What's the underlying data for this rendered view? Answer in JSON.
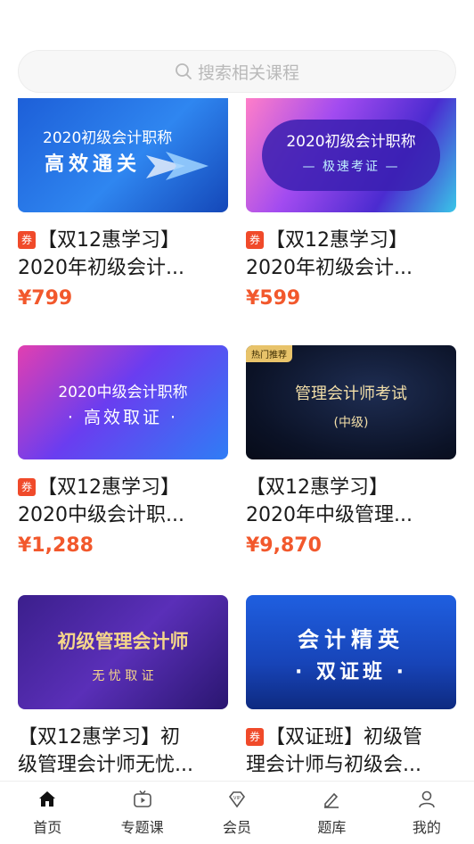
{
  "search": {
    "placeholder": "搜索相关课程"
  },
  "courses": [
    {
      "banner_line1": "2020初级会计职称",
      "banner_line2": "高效通关",
      "coupon": true,
      "title_line1": "【双12惠学习】",
      "title_line2": "2020年初级会计...",
      "price": "¥799"
    },
    {
      "banner_line1": "2020初级会计职称",
      "banner_line2": "— 极速考证 —",
      "coupon": true,
      "title_line1": "【双12惠学习】",
      "title_line2": "2020年初级会计...",
      "price": "¥599"
    },
    {
      "banner_line1": "2020中级会计职称",
      "banner_line2": "· 高效取证 ·",
      "coupon": true,
      "title_line1": "【双12惠学习】",
      "title_line2": "2020中级会计职...",
      "price": "¥1,288"
    },
    {
      "tag": "热门推荐",
      "banner_line1": "管理会计师考试",
      "banner_line2": "(中级)",
      "coupon": false,
      "title_line1": "【双12惠学习】",
      "title_line2": "2020年中级管理...",
      "price": "¥9,870"
    },
    {
      "banner_line1": "初级管理会计师",
      "banner_line2": "无 忧 取 证",
      "coupon": false,
      "title_line1": "【双12惠学习】初",
      "title_line2": "级管理会计师无忧...",
      "price": ""
    },
    {
      "banner_line1": "会计精英",
      "banner_line2": "· 双证班 ·",
      "coupon": true,
      "title_line1": "【双证班】初级管",
      "title_line2": "理会计师与初级会...",
      "price": ""
    }
  ],
  "coupon_label": "券",
  "tabs": [
    {
      "label": "首页",
      "icon": "home-icon"
    },
    {
      "label": "专题课",
      "icon": "tv-icon"
    },
    {
      "label": "会员",
      "icon": "vip-icon"
    },
    {
      "label": "题库",
      "icon": "pen-icon"
    },
    {
      "label": "我的",
      "icon": "user-icon"
    }
  ]
}
